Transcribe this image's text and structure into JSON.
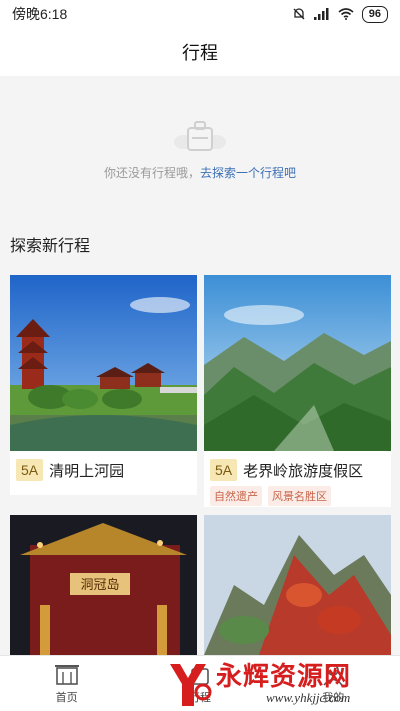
{
  "status_bar": {
    "time": "傍晚6:18",
    "battery": "96"
  },
  "header": {
    "title": "行程"
  },
  "empty_state": {
    "message": "你还没有行程哦，",
    "link": "去探索一个行程吧"
  },
  "explore": {
    "title": "探索新行程",
    "cards": [
      {
        "grade": "5A",
        "name": "清明上河园",
        "tags": []
      },
      {
        "grade": "5A",
        "name": "老界岭旅游度假区",
        "tags": [
          "自然遗产",
          "风景名胜区"
        ]
      },
      {
        "image_text": "洞冠岛"
      }
    ]
  },
  "bottom_nav": {
    "items": [
      {
        "label": "首页"
      },
      {
        "label": "行程"
      },
      {
        "label": "我的"
      }
    ]
  },
  "watermark": {
    "name": "永辉资源网",
    "url": "www.yhkjjc.com"
  },
  "colors": {
    "link": "#3d6fb5",
    "grade_bg": "#f6e7b4",
    "tag_text": "#c8654a",
    "watermark": "#d71e1e"
  }
}
